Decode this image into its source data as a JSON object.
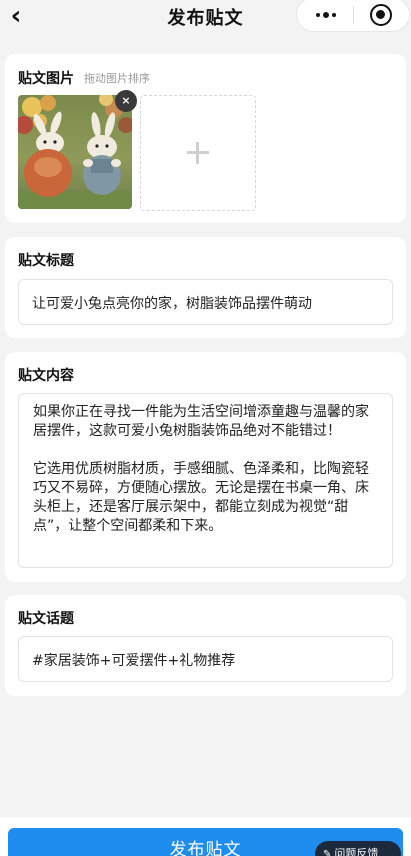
{
  "nav": {
    "back_icon": "chevron-left-icon",
    "title": "发布贴文",
    "more_icon": "more-dots-icon",
    "close_icon": "miniprogram-close-icon"
  },
  "images_section": {
    "title": "贴文图片",
    "hint": "拖动图片排序",
    "remove_icon": "close-icon",
    "remove_glyph": "×",
    "add_icon": "plus-icon"
  },
  "title_section": {
    "title": "贴文标题",
    "value": "让可爱小兔点亮你的家，树脂装饰品摆件萌动"
  },
  "content_section": {
    "title": "贴文内容",
    "paragraphs": [
      "如果你正在寻找一件能为生活空间增添童趣与温馨的家居摆件，这款可爱小兔树脂装饰品绝对不能错过！",
      "它选用优质树脂材质，手感细腻、色泽柔和，比陶瓷轻巧又不易碎，方便随心摆放。无论是摆在书桌一角、床头柜上，还是客厅展示架中，都能立刻成为视觉“甜点”，让整个空间都柔和下来。"
    ]
  },
  "topic_section": {
    "title": "贴文话题",
    "value": "#家居装饰+可爱摆件+礼物推荐"
  },
  "footer": {
    "publish_label": "发布贴文",
    "feedback_label": "问题反馈",
    "feedback_icon": "feedback-icon"
  },
  "colors": {
    "accent": "#1f8cf0",
    "background": "#f3f3f3",
    "card": "#ffffff"
  }
}
